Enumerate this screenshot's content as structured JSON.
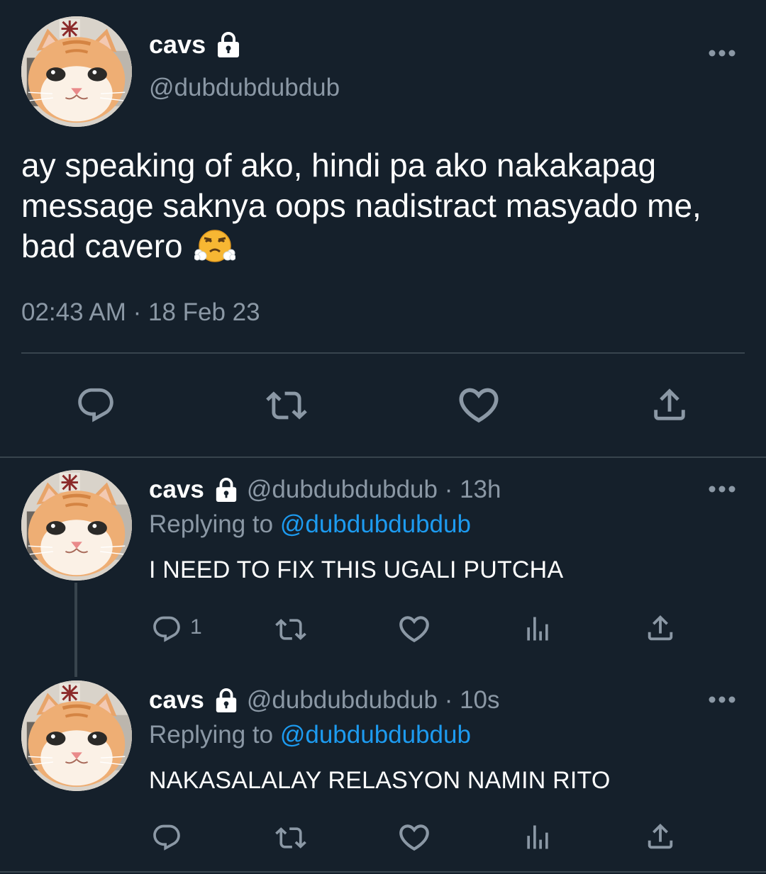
{
  "main_tweet": {
    "display_name": "cavs",
    "handle": "@dubdubdubdub",
    "text_line1": "ay speaking of ako, hindi pa ako nakakapag",
    "text_line2": "message saknya oops nadistract masyado me,",
    "text_line3": "bad cavero",
    "emoji": "face-with-steam-from-nose",
    "timestamp": "02:43 AM · 18 Feb 23",
    "actions": [
      "reply-icon",
      "retweet-icon",
      "like-icon",
      "share-icon"
    ]
  },
  "replies": [
    {
      "display_name": "cavs",
      "meta": "@dubdubdubdub · 13h",
      "replying_to_label": "Replying to",
      "replying_to_handle": "@dubdubdubdub",
      "text": "I NEED TO FIX THIS UGALI PUTCHA",
      "reply_count": "1"
    },
    {
      "display_name": "cavs",
      "meta": "@dubdubdubdub · 10s",
      "replying_to_label": "Replying to",
      "replying_to_handle": "@dubdubdubdub",
      "text": "NAKASALALAY RELASYON NAMIN RITO",
      "reply_count": ""
    }
  ],
  "colors": {
    "background": "#15202b",
    "secondary_text": "#8b98a5",
    "link": "#1d9bf0",
    "divider": "#38444d"
  }
}
